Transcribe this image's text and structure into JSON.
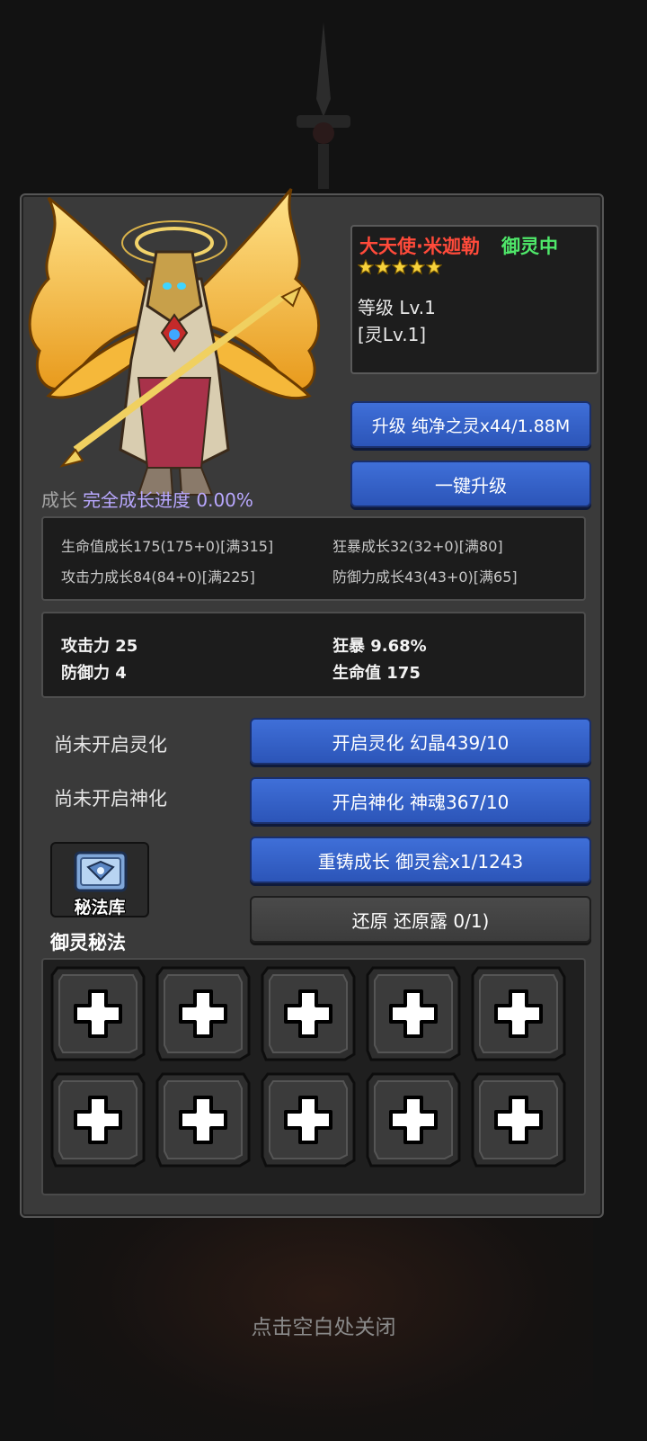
{
  "hero": {
    "name": "大天使·米迦勒",
    "status": "御灵中",
    "stars": 5,
    "level": "等级 Lv.1",
    "spirit_level": "[灵Lv.1]"
  },
  "buttons": {
    "upgrade": "升级 纯净之灵x44/1.88M",
    "one_click_upgrade": "一键升级",
    "open_spirit": "开启灵化 幻晶439/10",
    "open_divine": "开启神化 神魂367/10",
    "recast": "重铸成长 御灵瓮x1/1243",
    "restore": "还原 还原露 0/1)"
  },
  "growth": {
    "label": "成长",
    "progress_text": "完全成长进度 0.00%",
    "stats": {
      "hp_growth": "生命值成长175(175+0)[满315]",
      "rage_growth": "狂暴成长32(32+0)[满80]",
      "atk_growth": "攻击力成长84(84+0)[满225]",
      "def_growth": "防御力成长43(43+0)[满65]"
    }
  },
  "attributes": {
    "atk": "攻击力 25",
    "def": "防御力 4",
    "rage": "狂暴 9.68%",
    "hp": "生命值 175"
  },
  "side": {
    "spirit_not_open": "尚未开启灵化",
    "divine_not_open": "尚未开启神化",
    "library": "秘法库",
    "secret_title": "御灵秘法"
  },
  "slots_icon": "plus-icon",
  "close_hint": "点击空白处关闭",
  "colors": {
    "name_red": "#ff4a3a",
    "status_green": "#4fe86a",
    "progress_purple": "#b9a8ff",
    "button_blue": "#3f6fd8",
    "star_gold": "#f7d23c"
  }
}
